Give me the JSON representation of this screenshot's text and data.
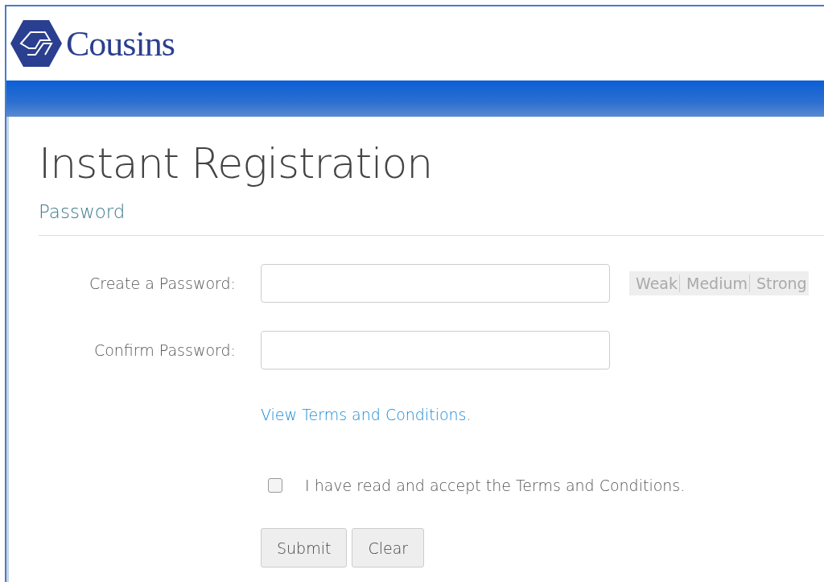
{
  "header": {
    "logo_text": "Cousins"
  },
  "page": {
    "title": "Instant Registration",
    "section": "Password"
  },
  "fields": [
    {
      "label": "Create a Password:",
      "has_strength": true
    },
    {
      "label": "Confirm Password:",
      "has_strength": false
    }
  ],
  "strength_levels": [
    "Weak",
    "Medium",
    "Strong"
  ],
  "terms_link": "View Terms and Conditions.",
  "accept": {
    "label": "I have read and accept the Terms and Conditions.",
    "checked": false
  },
  "buttons": [
    "Submit",
    "Clear"
  ]
}
